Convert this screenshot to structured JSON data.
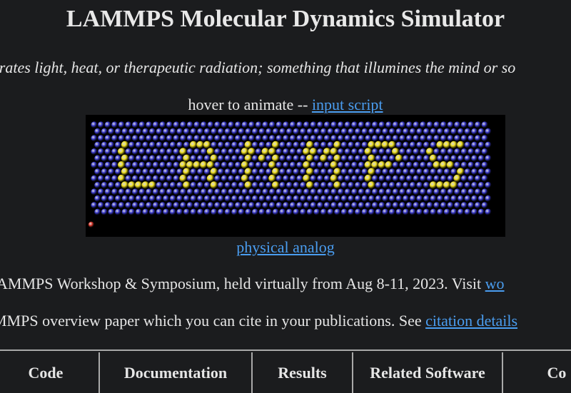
{
  "header": {
    "title": "LAMMPS Molecular Dynamics Simulator",
    "tagline": "nerates light, heat, or therapeutic radiation; something that illumines the mind or so"
  },
  "animation": {
    "hover_text": "hover to animate -- ",
    "input_script_link": "input script",
    "physical_analog_link": "physical analog",
    "colors": {
      "background": "#000000",
      "blue_atom": "#3c3cd2",
      "yellow_atom": "#f0e020",
      "red_atom": "#e03a2e"
    }
  },
  "news": {
    "line1_text": "AMMPS Workshop & Symposium, held virtually from Aug 8-11, 2023. Visit ",
    "line1_link": "wo",
    "line2_text": "MMPS overview paper which you can cite in your publications. See ",
    "line2_link": "citation details"
  },
  "nav": {
    "items": [
      {
        "label": "Code"
      },
      {
        "label": "Documentation"
      },
      {
        "label": "Results"
      },
      {
        "label": "Related Software"
      },
      {
        "label": "Co"
      }
    ]
  },
  "colors": {
    "page_background": "#1b1c1e",
    "text": "#e6e6e6",
    "link": "#4a9df0",
    "divider": "#a9a9a9"
  }
}
